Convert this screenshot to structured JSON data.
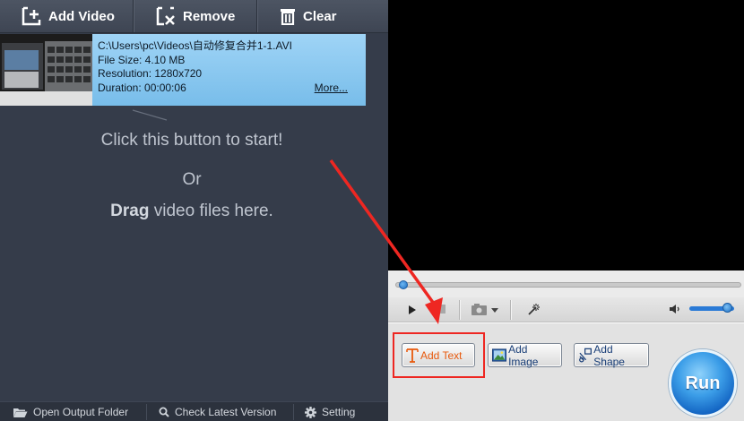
{
  "toolbar": {
    "add_video_label": "Add Video",
    "remove_label": "Remove",
    "clear_label": "Clear"
  },
  "file": {
    "path": "C:\\Users\\pc\\Videos\\自动修复合并1-1.AVI",
    "size": "File Size: 4.10 MB",
    "resolution": "Resolution: 1280x720",
    "duration": "Duration: 00:00:06",
    "more_label": "More..."
  },
  "hints": {
    "click_to_start": "Click this button to start!",
    "or": "Or",
    "drag_bold": "Drag",
    "drag_rest": " video files here."
  },
  "bottom_bar": {
    "open_output_folder": "Open Output Folder",
    "check_latest_version": "Check Latest Version",
    "setting": "Setting"
  },
  "player": {
    "progress": 0.0,
    "volume": 0.85
  },
  "edit": {
    "add_text_label": "Add Text",
    "add_image_label": "Add Image",
    "add_shape_label": "Add Shape",
    "run_label": "Run"
  },
  "icons": {
    "add_video": "add-video-icon",
    "remove": "remove-icon",
    "clear": "trash-icon",
    "play": "play-icon",
    "stop": "stop-icon",
    "snapshot": "camera-icon",
    "effects": "magic-wand-icon",
    "volume": "speaker-icon",
    "folder": "folder-icon",
    "search": "search-icon",
    "gear": "gear-icon"
  },
  "colors": {
    "left_panel_bg": "#353c4a",
    "file_info_bg": "#8ccbf3",
    "annotation_red": "#ee2722",
    "accent_blue": "#2a7ad6",
    "add_text_orange": "#e8590c"
  }
}
